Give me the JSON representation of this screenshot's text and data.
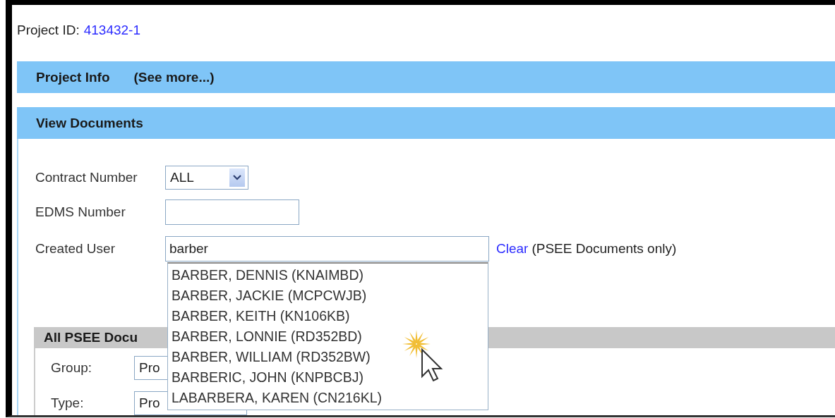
{
  "project": {
    "label": "Project ID:",
    "id": "413432-1"
  },
  "sections": [
    {
      "title": "Project Info",
      "link": "(See more...)"
    },
    {
      "title": "View Documents"
    }
  ],
  "fields": [
    {
      "kind": "select",
      "label": "Contract Number",
      "value": "ALL"
    },
    {
      "kind": "text",
      "label": "EDMS Number"
    },
    {
      "kind": "autocomplete",
      "label": "Created User",
      "value": "barber",
      "link": "Clear",
      "note": "(PSEE Documents only)"
    }
  ],
  "suggestions": [
    "BARBER, DENNIS (KNAIMBD)",
    "BARBER, JACKIE (MCPCWJB)",
    "BARBER, KEITH (KN106KB)",
    "BARBER, LONNIE (RD352BD)",
    "BARBER, WILLIAM (RD352BW)",
    "BARBERIC, JOHN (KNPBCBJ)",
    "LABARBERA, KAREN (CN216KL)"
  ],
  "subsection": {
    "title": "All PSEE Docu",
    "fields": [
      {
        "label": "Group:",
        "value": "Pro"
      },
      {
        "label": "Type:",
        "value": "Pro"
      }
    ]
  }
}
